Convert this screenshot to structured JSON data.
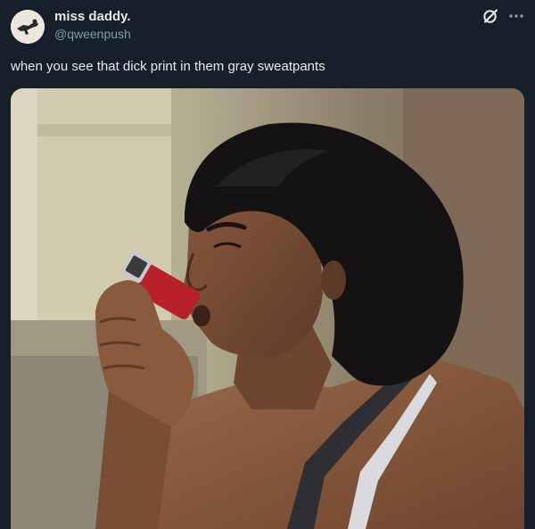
{
  "author": {
    "display_name": "miss daddy.",
    "handle": "@qweenpush",
    "avatar_icon": "avatar-icon"
  },
  "actions": {
    "grok_icon": "grok-icon",
    "more_icon": "more-icon"
  },
  "tweet": {
    "text": "when you see that dick print in them gray sweatpants"
  },
  "media": {
    "type": "photo",
    "subject_icon": "person-using-inhaler-photo"
  },
  "colors": {
    "background": "#15202b",
    "text_primary": "#e7e9ea",
    "text_secondary": "#8b98a5"
  }
}
